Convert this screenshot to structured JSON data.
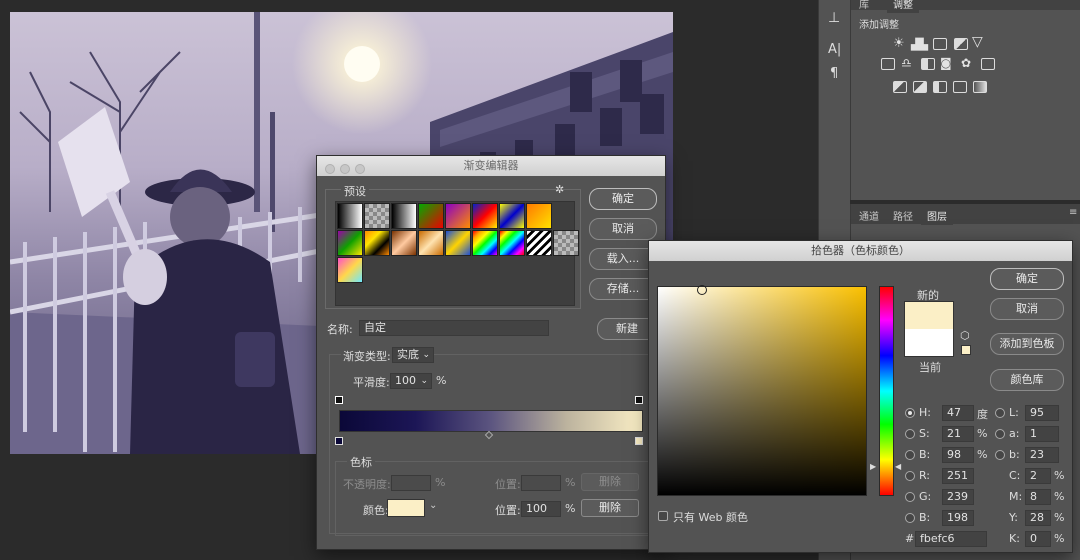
{
  "adjustments": {
    "tabs": [
      "库",
      "调整"
    ],
    "add_label": "添加调整"
  },
  "layers": {
    "tabs": [
      "通道",
      "路径",
      "图层"
    ]
  },
  "gradient_editor": {
    "title": "渐变编辑器",
    "presets_label": "预设",
    "buttons": {
      "ok": "确定",
      "cancel": "取消",
      "load": "载入...",
      "save": "存储...",
      "new": "新建"
    },
    "name_label": "名称:",
    "name_value": "自定",
    "type_label": "渐变类型:",
    "type_value": "实底",
    "smooth_label": "平滑度:",
    "smooth_value": "100",
    "smooth_unit": "%",
    "gradient_colors": [
      "#0b0838",
      "#1c1656",
      "#5c5580",
      "#bcb39e",
      "#fbefc6"
    ],
    "stops_section": "色标",
    "opacity_label": "不透明度:",
    "opacity_unit": "%",
    "opacity_pos_label": "位置:",
    "opacity_pos_unit": "%",
    "opacity_delete": "删除",
    "color_label": "颜色:",
    "color_value": "#fbefc6",
    "color_pos_label": "位置:",
    "color_pos_value": "100",
    "color_pos_unit": "%",
    "color_delete": "删除"
  },
  "color_picker": {
    "title": "拾色器（色标颜色）",
    "new_label": "新的",
    "current_label": "当前",
    "new_color": "#fbefc6",
    "current_color": "#ffffff",
    "buttons": {
      "ok": "确定",
      "cancel": "取消",
      "add_swatch": "添加到色板",
      "libraries": "颜色库"
    },
    "hsb": {
      "h": "47",
      "h_unit": "度",
      "s": "21",
      "s_unit": "%",
      "b": "98",
      "b_unit": "%"
    },
    "rgb": {
      "r": "251",
      "g": "239",
      "b": "198"
    },
    "lab": {
      "l": "95",
      "a": "1",
      "b": "23"
    },
    "cmyk": {
      "c": "2",
      "m": "8",
      "y": "28",
      "k": "0",
      "unit": "%"
    },
    "hex_prefix": "#",
    "hex": "fbefc6",
    "web_only_label": "只有 Web 颜色",
    "labels": {
      "H": "H:",
      "S": "S:",
      "B": "B:",
      "R": "R:",
      "G": "G:",
      "B2": "B:",
      "L": "L:",
      "a": "a:",
      "b": "b:",
      "C": "C:",
      "M": "M:",
      "Y": "Y:",
      "K": "K:"
    }
  }
}
